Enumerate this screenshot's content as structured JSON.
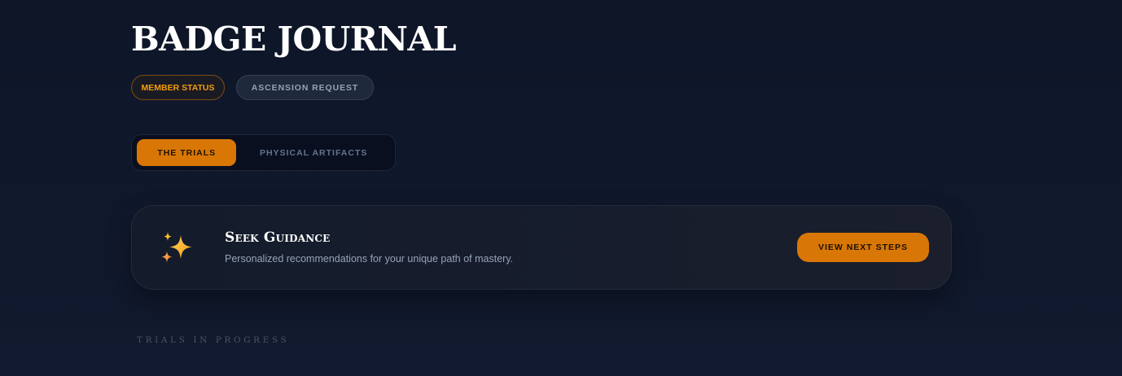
{
  "page": {
    "title": "BADGE JOURNAL",
    "section_label": "TRIALS IN PROGRESS"
  },
  "badges": {
    "member_status": "MEMBER STATUS",
    "ascension_request": "ASCENSION REQUEST"
  },
  "tabs": [
    {
      "label": "THE TRIALS",
      "active": true
    },
    {
      "label": "PHYSICAL ARTIFACTS",
      "active": false
    }
  ],
  "guidance_card": {
    "icon": "sparkles-icon",
    "title": "Seek Guidance",
    "description": "Personalized recommendations for your unique path of mastery.",
    "button_label": "VIEW NEXT STEPS"
  },
  "colors": {
    "background": "#0f172a",
    "accent": "#d97706",
    "accent_text": "#f59e0b",
    "muted_text": "#94a3b8"
  }
}
